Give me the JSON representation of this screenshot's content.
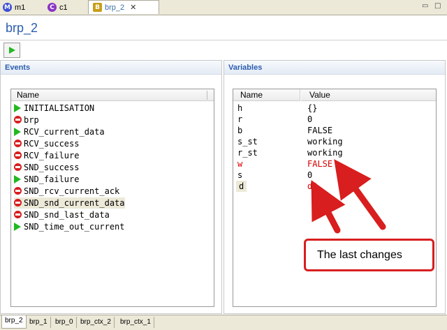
{
  "tabs": [
    {
      "label": "m1",
      "icon": "machine-icon",
      "icon_letter": "M",
      "icon_color": "#3b4fd6"
    },
    {
      "label": "c1",
      "icon": "context-icon",
      "icon_letter": "C",
      "icon_color": "#8a35c4"
    },
    {
      "label": "brp_2",
      "icon": "breakpoint-file-icon",
      "icon_letter": "B",
      "icon_color": "#c89d18",
      "active": true
    }
  ],
  "page_title": "brp_2",
  "events": {
    "section_title": "Events",
    "column_header": "Name",
    "items": [
      {
        "label": "INITIALISATION",
        "status": "enabled"
      },
      {
        "label": "brp",
        "status": "disabled"
      },
      {
        "label": "RCV_current_data",
        "status": "enabled"
      },
      {
        "label": "RCV_success",
        "status": "disabled"
      },
      {
        "label": "RCV_failure",
        "status": "disabled"
      },
      {
        "label": "SND_success",
        "status": "disabled"
      },
      {
        "label": "SND_failure",
        "status": "enabled"
      },
      {
        "label": "SND_rcv_current_ack",
        "status": "disabled"
      },
      {
        "label": "SND_snd_current_data",
        "status": "disabled",
        "selected": true
      },
      {
        "label": "SND_snd_last_data",
        "status": "disabled"
      },
      {
        "label": "SND_time_out_current",
        "status": "enabled"
      }
    ]
  },
  "variables": {
    "section_title": "Variables",
    "col_name": "Name",
    "col_value": "Value",
    "rows": [
      {
        "name": "h",
        "value": "{}",
        "changed": false
      },
      {
        "name": "r",
        "value": "0",
        "changed": false
      },
      {
        "name": "b",
        "value": "FALSE",
        "changed": false
      },
      {
        "name": "s_st",
        "value": "working",
        "changed": false
      },
      {
        "name": "r_st",
        "value": "working",
        "changed": false
      },
      {
        "name": "w",
        "value": "FALSE",
        "changed": true
      },
      {
        "name": "s",
        "value": "0",
        "changed": false
      },
      {
        "name": "d",
        "value": "d2",
        "changed": true
      }
    ]
  },
  "annotation": {
    "text": "The last changes",
    "color": "#d81e1e"
  },
  "bottom_tabs": [
    "brp_2",
    "brp_1",
    "brp_0",
    "brp_ctx_2",
    "brp_ctx_1"
  ],
  "colors": {
    "enabled": "#22b822",
    "disabled": "#d81e1e",
    "changed": "#d40000",
    "title": "#2a5db0"
  }
}
